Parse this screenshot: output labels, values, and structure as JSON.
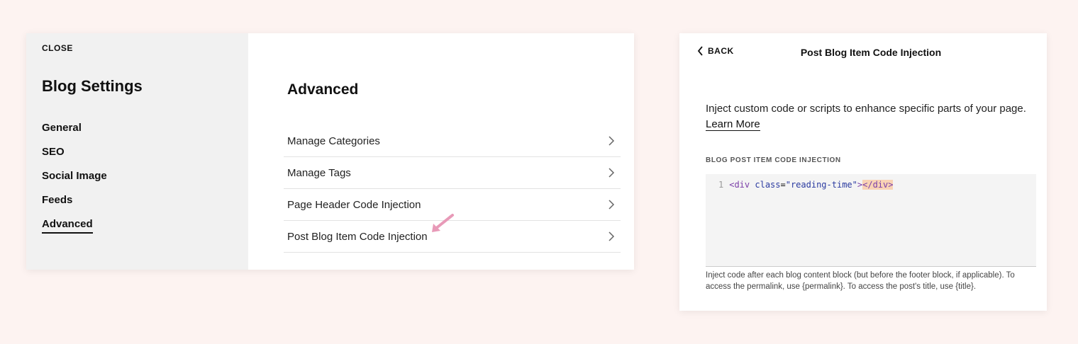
{
  "settings": {
    "close_label": "CLOSE",
    "title": "Blog Settings",
    "nav": [
      {
        "label": "General",
        "active": false
      },
      {
        "label": "SEO",
        "active": false
      },
      {
        "label": "Social Image",
        "active": false
      },
      {
        "label": "Feeds",
        "active": false
      },
      {
        "label": "Advanced",
        "active": true
      }
    ]
  },
  "advanced": {
    "title": "Advanced",
    "items": [
      {
        "label": "Manage Categories"
      },
      {
        "label": "Manage Tags"
      },
      {
        "label": "Page Header Code Injection"
      },
      {
        "label": "Post Blog Item Code Injection"
      }
    ],
    "annotation_color": "#e89ab8"
  },
  "injection_panel": {
    "back_label": "BACK",
    "title": "Post Blog Item Code Injection",
    "description": "Inject custom code or scripts to enhance specific parts of your page.",
    "learn_more": "Learn More",
    "section_label": "BLOG POST ITEM CODE INJECTION",
    "code": {
      "line_number": "1",
      "open_tag": "<div",
      "attr_name": "class",
      "equals": "=",
      "attr_value": "\"reading-time\"",
      "open_close": ">",
      "close_tag": "</div>"
    },
    "help_text": "Inject code after each blog content block (but before the footer block, if applicable). To access the permalink, use {permalink}. To access the post's title, use {title}."
  }
}
